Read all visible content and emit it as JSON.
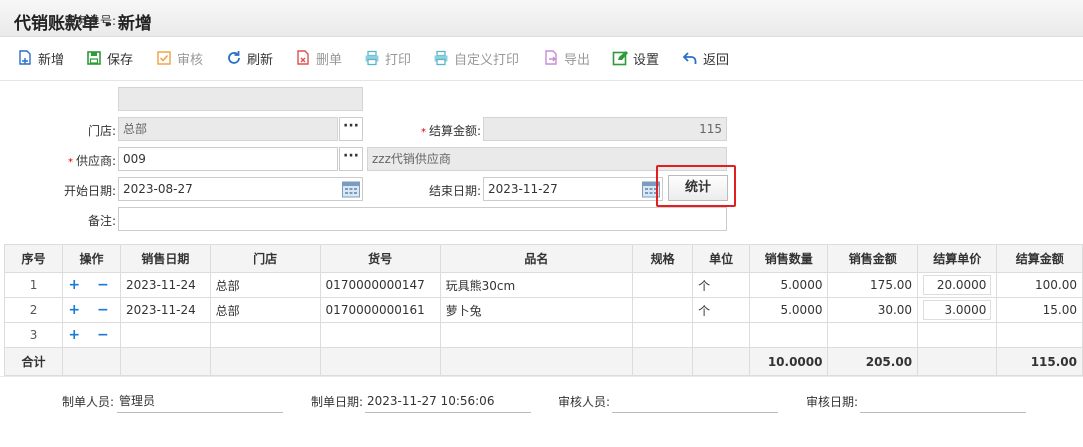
{
  "window": {
    "title": "代销账款单 - 新增"
  },
  "toolbar": {
    "add": "新增",
    "save": "保存",
    "audit": "审核",
    "refresh": "刷新",
    "delete": "删单",
    "print": "打印",
    "custom_print": "自定义打印",
    "export": "导出",
    "settings": "设置",
    "back": "返回"
  },
  "form": {
    "order_no": {
      "label": "业务单号:",
      "value": ""
    },
    "store": {
      "label": "门店:",
      "value": "总部"
    },
    "settle_amount": {
      "label": "结算金额:",
      "value": "115"
    },
    "supplier": {
      "label": "供应商:",
      "code": "009",
      "name": "zzz代销供应商"
    },
    "start_date": {
      "label": "开始日期:",
      "value": "2023-08-27"
    },
    "end_date": {
      "label": "结束日期:",
      "value": "2023-11-27"
    },
    "remark": {
      "label": "备注:",
      "value": ""
    },
    "stat_button": "统计"
  },
  "grid": {
    "columns": [
      "序号",
      "操作",
      "销售日期",
      "门店",
      "货号",
      "品名",
      "规格",
      "单位",
      "销售数量",
      "销售金额",
      "结算单价",
      "结算金额"
    ],
    "rows": [
      {
        "no": "1",
        "date": "2023-11-24",
        "store": "总部",
        "sku": "0170000000147",
        "name": "玩具熊30cm",
        "spec": "",
        "unit": "个",
        "qty": "5.0000",
        "sales": "175.00",
        "price": "20.0000",
        "amount": "100.00"
      },
      {
        "no": "2",
        "date": "2023-11-24",
        "store": "总部",
        "sku": "0170000000161",
        "name": "萝卜兔",
        "spec": "",
        "unit": "个",
        "qty": "5.0000",
        "sales": "30.00",
        "price": "3.0000",
        "amount": "15.00"
      },
      {
        "no": "3",
        "date": "",
        "store": "",
        "sku": "",
        "name": "",
        "spec": "",
        "unit": "",
        "qty": "",
        "sales": "",
        "price": "",
        "amount": ""
      }
    ],
    "row_actions": "+ −",
    "total": {
      "label": "合计",
      "qty": "10.0000",
      "sales": "205.00",
      "amount": "115.00"
    }
  },
  "footer": {
    "maker": {
      "label": "制单人员:",
      "value": "管理员"
    },
    "make_date": {
      "label": "制单日期:",
      "value": "2023-11-27 10:56:06"
    },
    "auditor": {
      "label": "审核人员:",
      "value": ""
    },
    "audit_date": {
      "label": "审核日期:",
      "value": ""
    }
  },
  "colors": {
    "accent_blue": "#1a7ad8",
    "highlight_red": "#e02020",
    "required_red": "#dd0000"
  }
}
